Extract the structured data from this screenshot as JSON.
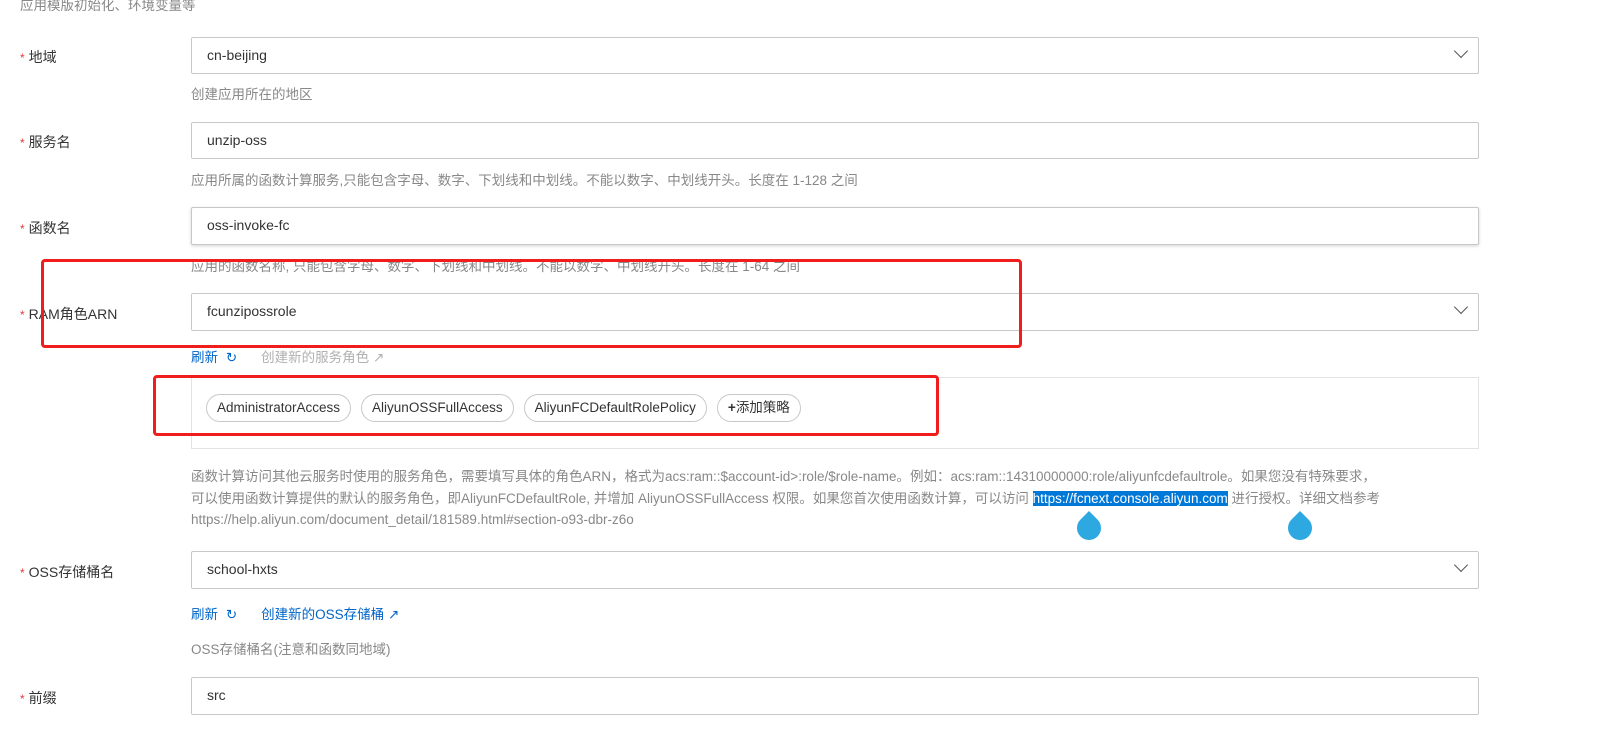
{
  "top_help": "应用模版初始化、环境变量等",
  "required_mark": "*",
  "region": {
    "label": "地域",
    "value": "cn-beijing",
    "help": "创建应用所在的地区"
  },
  "service": {
    "label": "服务名",
    "value": "unzip-oss",
    "help": "应用所属的函数计算服务,只能包含字母、数字、下划线和中划线。不能以数字、中划线开头。长度在 1-128 之间"
  },
  "function": {
    "label": "函数名",
    "value": "oss-invoke-fc",
    "help": "应用的函数名称, 只能包含字母、数字、下划线和中划线。不能以数字、中划线开头。长度在 1-64 之间"
  },
  "ram": {
    "label": "RAM角色ARN",
    "value": "fcunzipossrole",
    "refresh": "刷新",
    "create": "创建新的服务角色",
    "policies": [
      "AdministratorAccess",
      "AliyunOSSFullAccess",
      "AliyunFCDefaultRolePolicy"
    ],
    "add_policy": "添加策略",
    "desc_line1": "函数计算访问其他云服务时使用的服务角色，需要填写具体的角色ARN，格式为acs:ram::$account-id>:role/$role-name。例如：acs:ram::14310000000:role/aliyunfcdefaultrole。如果您没有特殊要求，",
    "desc_line2_pre": "可以使用函数计算提供的默认的服务角色，即AliyunFCDefaultRole, 并增加 AliyunOSSFullAccess 权限。如果您首次使用函数计算，可以访问 ",
    "desc_link": "https://fcnext.console.aliyun.com",
    "desc_line2_post": " 进行授权。详细文档参考",
    "desc_line3": "https://help.aliyun.com/document_detail/181589.html#section-o93-dbr-z6o"
  },
  "oss": {
    "label": "OSS存储桶名",
    "value": "school-hxts",
    "refresh": "刷新",
    "create": "创建新的OSS存储桶",
    "help": "OSS存储桶名(注意和函数同地域)"
  },
  "prefix": {
    "label": "前缀",
    "value": "src"
  }
}
